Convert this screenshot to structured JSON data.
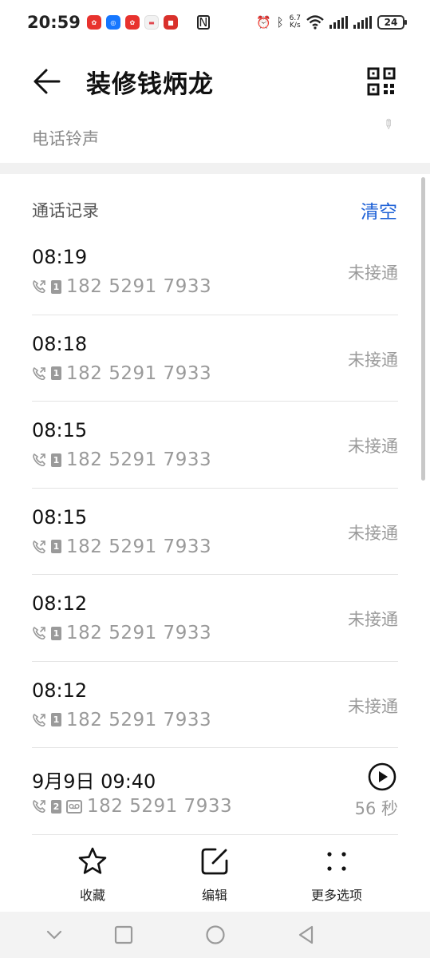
{
  "status_bar": {
    "time": "20:59",
    "speed_top": "6.7",
    "speed_bottom": "K/s",
    "battery": "24",
    "app_icons": [
      {
        "name": "pinduoduo-icon",
        "color": "#e8322e"
      },
      {
        "name": "alipay-like-icon",
        "color": "#1677ff"
      },
      {
        "name": "pinduoduo-icon-2",
        "color": "#e8322e"
      },
      {
        "name": "message-icon",
        "color": "#e0484f"
      },
      {
        "name": "news-icon",
        "color": "#d9302b"
      }
    ]
  },
  "header": {
    "title": "装修钱炳龙",
    "ringtone_label": "电话铃声"
  },
  "call_log": {
    "title": "通话记录",
    "clear_label": "清空",
    "entries": [
      {
        "time": "08:19",
        "sim": "1",
        "number": "182 5291 7933",
        "status": "未接通"
      },
      {
        "time": "08:18",
        "sim": "1",
        "number": "182 5291 7933",
        "status": "未接通"
      },
      {
        "time": "08:15",
        "sim": "1",
        "number": "182 5291 7933",
        "status": "未接通"
      },
      {
        "time": "08:15",
        "sim": "1",
        "number": "182 5291 7933",
        "status": "未接通"
      },
      {
        "time": "08:12",
        "sim": "1",
        "number": "182 5291 7933",
        "status": "未接通"
      },
      {
        "time": "08:12",
        "sim": "1",
        "number": "182 5291 7933",
        "status": "未接通"
      },
      {
        "time": "9月9日 09:40",
        "sim": "2",
        "number": "182 5291 7933",
        "duration": "56 秒"
      }
    ]
  },
  "actions": {
    "favorite": "收藏",
    "edit": "编辑",
    "more": "更多选项"
  },
  "colors": {
    "accent": "#1b5fd6",
    "muted_text": "#9a9a9a"
  }
}
